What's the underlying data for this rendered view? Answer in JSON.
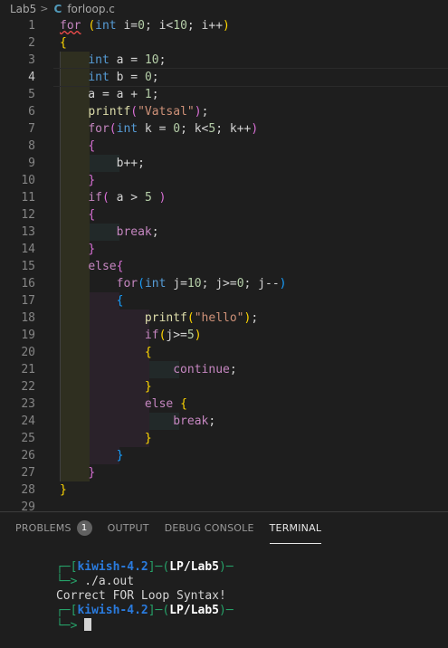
{
  "breadcrumb": {
    "folder": "Lab5",
    "separator": ">",
    "lang_icon": "C",
    "file": "forloop.c"
  },
  "editor": {
    "active_line": 4,
    "lines": [
      {
        "n": "1",
        "tokens": [
          {
            "t": "for",
            "c": "ctl squiggle"
          },
          {
            "t": " "
          },
          {
            "t": "(",
            "c": "brk1"
          },
          {
            "t": "int",
            "c": "kw"
          },
          {
            "t": " i="
          },
          {
            "t": "0",
            "c": "num"
          },
          {
            "t": "; i<"
          },
          {
            "t": "10",
            "c": "num"
          },
          {
            "t": "; i++"
          },
          {
            "t": ")",
            "c": "brk1"
          }
        ]
      },
      {
        "n": "2",
        "tokens": [
          {
            "t": "{",
            "c": "brk1"
          }
        ]
      },
      {
        "n": "3",
        "tokens": [
          {
            "t": "    "
          },
          {
            "t": "int",
            "c": "kw"
          },
          {
            "t": " a = "
          },
          {
            "t": "10",
            "c": "num"
          },
          {
            "t": ";"
          }
        ]
      },
      {
        "n": "4",
        "tokens": [
          {
            "t": "    "
          },
          {
            "t": "int",
            "c": "kw"
          },
          {
            "t": " b = "
          },
          {
            "t": "0",
            "c": "num"
          },
          {
            "t": ";"
          }
        ]
      },
      {
        "n": "5",
        "tokens": [
          {
            "t": "    a = a + "
          },
          {
            "t": "1",
            "c": "num"
          },
          {
            "t": ";"
          }
        ]
      },
      {
        "n": "6",
        "tokens": [
          {
            "t": "    "
          },
          {
            "t": "printf",
            "c": "fn"
          },
          {
            "t": "(",
            "c": "brk2"
          },
          {
            "t": "\"Vatsal\"",
            "c": "str"
          },
          {
            "t": ")",
            "c": "brk2"
          },
          {
            "t": ";"
          }
        ]
      },
      {
        "n": "7",
        "tokens": [
          {
            "t": "    "
          },
          {
            "t": "for",
            "c": "ctl"
          },
          {
            "t": "(",
            "c": "brk2"
          },
          {
            "t": "int",
            "c": "kw"
          },
          {
            "t": " k = "
          },
          {
            "t": "0",
            "c": "num"
          },
          {
            "t": "; k<"
          },
          {
            "t": "5",
            "c": "num"
          },
          {
            "t": "; k++"
          },
          {
            "t": ")",
            "c": "brk2"
          }
        ]
      },
      {
        "n": "8",
        "tokens": [
          {
            "t": "    "
          },
          {
            "t": "{",
            "c": "brk2"
          }
        ]
      },
      {
        "n": "9",
        "tokens": [
          {
            "t": "        b++;"
          }
        ]
      },
      {
        "n": "10",
        "tokens": [
          {
            "t": "    "
          },
          {
            "t": "}",
            "c": "brk2"
          }
        ]
      },
      {
        "n": "11",
        "tokens": [
          {
            "t": "    "
          },
          {
            "t": "if",
            "c": "ctl"
          },
          {
            "t": "(",
            "c": "brk2"
          },
          {
            "t": " a > "
          },
          {
            "t": "5",
            "c": "num"
          },
          {
            "t": " "
          },
          {
            "t": ")",
            "c": "brk2"
          }
        ]
      },
      {
        "n": "12",
        "tokens": [
          {
            "t": "    "
          },
          {
            "t": "{",
            "c": "brk2"
          }
        ]
      },
      {
        "n": "13",
        "tokens": [
          {
            "t": "        "
          },
          {
            "t": "break",
            "c": "ctl"
          },
          {
            "t": ";"
          }
        ]
      },
      {
        "n": "14",
        "tokens": [
          {
            "t": "    "
          },
          {
            "t": "}",
            "c": "brk2"
          }
        ]
      },
      {
        "n": "15",
        "tokens": [
          {
            "t": "    "
          },
          {
            "t": "else",
            "c": "ctl"
          },
          {
            "t": "{",
            "c": "brk2"
          }
        ]
      },
      {
        "n": "16",
        "tokens": [
          {
            "t": "        "
          },
          {
            "t": "for",
            "c": "ctl"
          },
          {
            "t": "(",
            "c": "brk3"
          },
          {
            "t": "int",
            "c": "kw"
          },
          {
            "t": " j="
          },
          {
            "t": "10",
            "c": "num"
          },
          {
            "t": "; j>="
          },
          {
            "t": "0",
            "c": "num"
          },
          {
            "t": "; j--"
          },
          {
            "t": ")",
            "c": "brk3"
          }
        ]
      },
      {
        "n": "17",
        "tokens": [
          {
            "t": "        "
          },
          {
            "t": "{",
            "c": "brk3"
          }
        ]
      },
      {
        "n": "18",
        "tokens": [
          {
            "t": "            "
          },
          {
            "t": "printf",
            "c": "fn"
          },
          {
            "t": "(",
            "c": "brk1"
          },
          {
            "t": "\"hello\"",
            "c": "str"
          },
          {
            "t": ")",
            "c": "brk1"
          },
          {
            "t": ";"
          }
        ]
      },
      {
        "n": "19",
        "tokens": [
          {
            "t": "            "
          },
          {
            "t": "if",
            "c": "ctl"
          },
          {
            "t": "(",
            "c": "brk1"
          },
          {
            "t": "j>="
          },
          {
            "t": "5",
            "c": "num"
          },
          {
            "t": ")",
            "c": "brk1"
          }
        ]
      },
      {
        "n": "20",
        "tokens": [
          {
            "t": "            "
          },
          {
            "t": "{",
            "c": "brk1"
          }
        ]
      },
      {
        "n": "21",
        "tokens": [
          {
            "t": "                "
          },
          {
            "t": "continue",
            "c": "ctl"
          },
          {
            "t": ";"
          }
        ]
      },
      {
        "n": "22",
        "tokens": [
          {
            "t": "            "
          },
          {
            "t": "}",
            "c": "brk1"
          }
        ]
      },
      {
        "n": "23",
        "tokens": [
          {
            "t": "            "
          },
          {
            "t": "else",
            "c": "ctl"
          },
          {
            "t": " "
          },
          {
            "t": "{",
            "c": "brk1"
          }
        ]
      },
      {
        "n": "24",
        "tokens": [
          {
            "t": "                "
          },
          {
            "t": "break",
            "c": "ctl"
          },
          {
            "t": ";"
          }
        ]
      },
      {
        "n": "25",
        "tokens": [
          {
            "t": "            "
          },
          {
            "t": "}",
            "c": "brk1"
          }
        ]
      },
      {
        "n": "26",
        "tokens": [
          {
            "t": "        "
          },
          {
            "t": "}",
            "c": "brk3"
          }
        ]
      },
      {
        "n": "27",
        "tokens": [
          {
            "t": "    "
          },
          {
            "t": "}",
            "c": "brk2"
          }
        ]
      },
      {
        "n": "28",
        "tokens": [
          {
            "t": "}",
            "c": "brk1"
          }
        ]
      },
      {
        "n": "29",
        "tokens": []
      }
    ]
  },
  "panel": {
    "tabs": [
      {
        "label": "PROBLEMS",
        "badge": "1"
      },
      {
        "label": "OUTPUT"
      },
      {
        "label": "DEBUG CONSOLE"
      },
      {
        "label": "TERMINAL",
        "active": true
      }
    ]
  },
  "terminal": {
    "prompt1": {
      "frame_open": "┌─[",
      "host": "kiwish-4.2",
      "mid": "]─(",
      "path": "LP/Lab5",
      "close": ")─"
    },
    "cmd_line": {
      "arrow": "└─> ",
      "command": "./a.out"
    },
    "output": "Correct FOR Loop Syntax!",
    "prompt2": {
      "frame_open": "┌─[",
      "host": "kiwish-4.2",
      "mid": "]─(",
      "path": "LP/Lab5",
      "close": ")─"
    },
    "arrow2": "└─> "
  }
}
